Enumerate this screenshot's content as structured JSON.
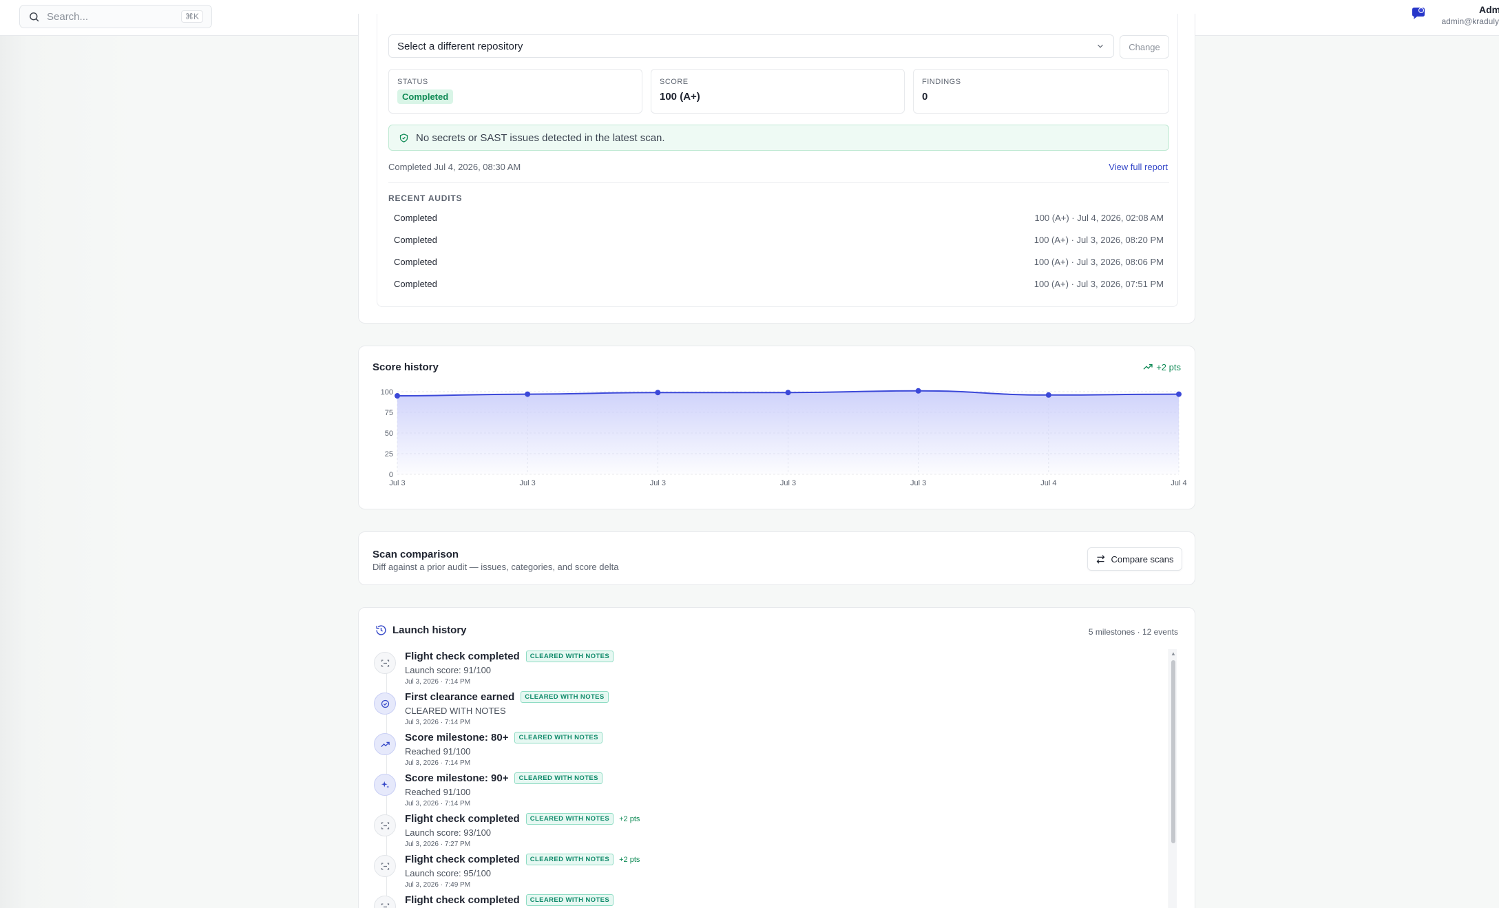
{
  "topbar": {
    "search_placeholder": "Search...",
    "search_shortcut": "⌘K",
    "user_name": "Admi",
    "user_email": "admin@kradulyi.c"
  },
  "audit": {
    "repo_select_label": "Select a different repository",
    "change_label": "Change",
    "status_label": "STATUS",
    "status_value": "Completed",
    "score_label": "SCORE",
    "score_value": "100 (A+)",
    "findings_label": "FINDINGS",
    "findings_value": "0",
    "banner_text": "No secrets or SAST issues detected in the latest scan.",
    "completed_at": "Completed Jul 4, 2026, 08:30 AM",
    "view_report_label": "View full report",
    "recent_title": "RECENT AUDITS",
    "recent": [
      {
        "status": "Completed",
        "meta": "100 (A+) · Jul 4, 2026, 02:08 AM"
      },
      {
        "status": "Completed",
        "meta": "100 (A+) · Jul 3, 2026, 08:20 PM"
      },
      {
        "status": "Completed",
        "meta": "100 (A+) · Jul 3, 2026, 08:06 PM"
      },
      {
        "status": "Completed",
        "meta": "100 (A+) · Jul 3, 2026, 07:51 PM"
      }
    ]
  },
  "score_history": {
    "title": "Score history",
    "delta": "+2 pts"
  },
  "chart_data": {
    "type": "area",
    "x": [
      "Jul 3",
      "Jul 3",
      "Jul 3",
      "Jul 3",
      "Jul 3",
      "Jul 4",
      "Jul 4"
    ],
    "values": [
      95,
      97,
      99,
      99,
      101,
      96,
      97
    ],
    "yticks": [
      0,
      25,
      50,
      75,
      100
    ],
    "ylim": [
      0,
      100
    ],
    "grid": true,
    "colors": {
      "line": "#3b48d8",
      "fill": "#c9cdfa"
    }
  },
  "comparison": {
    "title": "Scan comparison",
    "subtitle": "Diff against a prior audit — issues, categories, and score delta",
    "button_label": "Compare scans"
  },
  "launch_history": {
    "title": "Launch history",
    "count": "5 milestones · 12 events",
    "events": [
      {
        "icon": "scan-icon",
        "title": "Flight check completed",
        "badge": "CLEARED WITH NOTES",
        "pts": "",
        "sub": "Launch score: 91/100",
        "time": "Jul 3, 2026 · 7:14 PM"
      },
      {
        "icon": "check-circle-icon",
        "title": "First clearance earned",
        "badge": "CLEARED WITH NOTES",
        "pts": "",
        "sub": "CLEARED WITH NOTES",
        "time": "Jul 3, 2026 · 7:14 PM"
      },
      {
        "icon": "trending-up-icon",
        "title": "Score milestone: 80+",
        "badge": "CLEARED WITH NOTES",
        "pts": "",
        "sub": "Reached 91/100",
        "time": "Jul 3, 2026 · 7:14 PM"
      },
      {
        "icon": "sparkles-icon",
        "title": "Score milestone: 90+",
        "badge": "CLEARED WITH NOTES",
        "pts": "",
        "sub": "Reached 91/100",
        "time": "Jul 3, 2026 · 7:14 PM"
      },
      {
        "icon": "scan-icon",
        "title": "Flight check completed",
        "badge": "CLEARED WITH NOTES",
        "pts": "+2 pts",
        "sub": "Launch score: 93/100",
        "time": "Jul 3, 2026 · 7:27 PM"
      },
      {
        "icon": "scan-icon",
        "title": "Flight check completed",
        "badge": "CLEARED WITH NOTES",
        "pts": "+2 pts",
        "sub": "Launch score: 95/100",
        "time": "Jul 3, 2026 · 7:49 PM"
      },
      {
        "icon": "scan-icon",
        "title": "Flight check completed",
        "badge": "CLEARED WITH NOTES",
        "pts": "",
        "sub": "",
        "time": ""
      }
    ]
  }
}
